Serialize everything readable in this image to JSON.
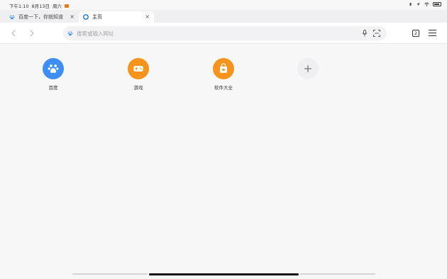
{
  "status_bar": {
    "time": "下午1:10",
    "date": "8月13日",
    "weekday": "周六",
    "notification_icon": "app-notification-icon",
    "right_icons": [
      "bluetooth-icon",
      "location-icon",
      "wifi-icon",
      "battery-icon"
    ]
  },
  "tabs": [
    {
      "title": "百度一下，你就知道",
      "favicon": "baidu-paw-icon",
      "active": false
    },
    {
      "title": "主页",
      "favicon": "browser-home-icon",
      "active": true
    }
  ],
  "toolbar": {
    "address_placeholder": "搜索或输入网址",
    "tab_count": "2"
  },
  "shortcuts": [
    {
      "label": "百度",
      "icon": "baidu-paw-icon",
      "color": "#3f8ff2"
    },
    {
      "label": "游戏",
      "icon": "gamepad-icon",
      "color": "#f5931d"
    },
    {
      "label": "软件大全",
      "icon": "shopping-bag-icon",
      "color": "#f5931d"
    },
    {
      "label": "",
      "icon": "plus-icon",
      "color": "#efeff1"
    }
  ],
  "colors": {
    "accent_blue": "#3f8ff2",
    "accent_orange": "#f5931d",
    "background": "#f7f7f8"
  }
}
